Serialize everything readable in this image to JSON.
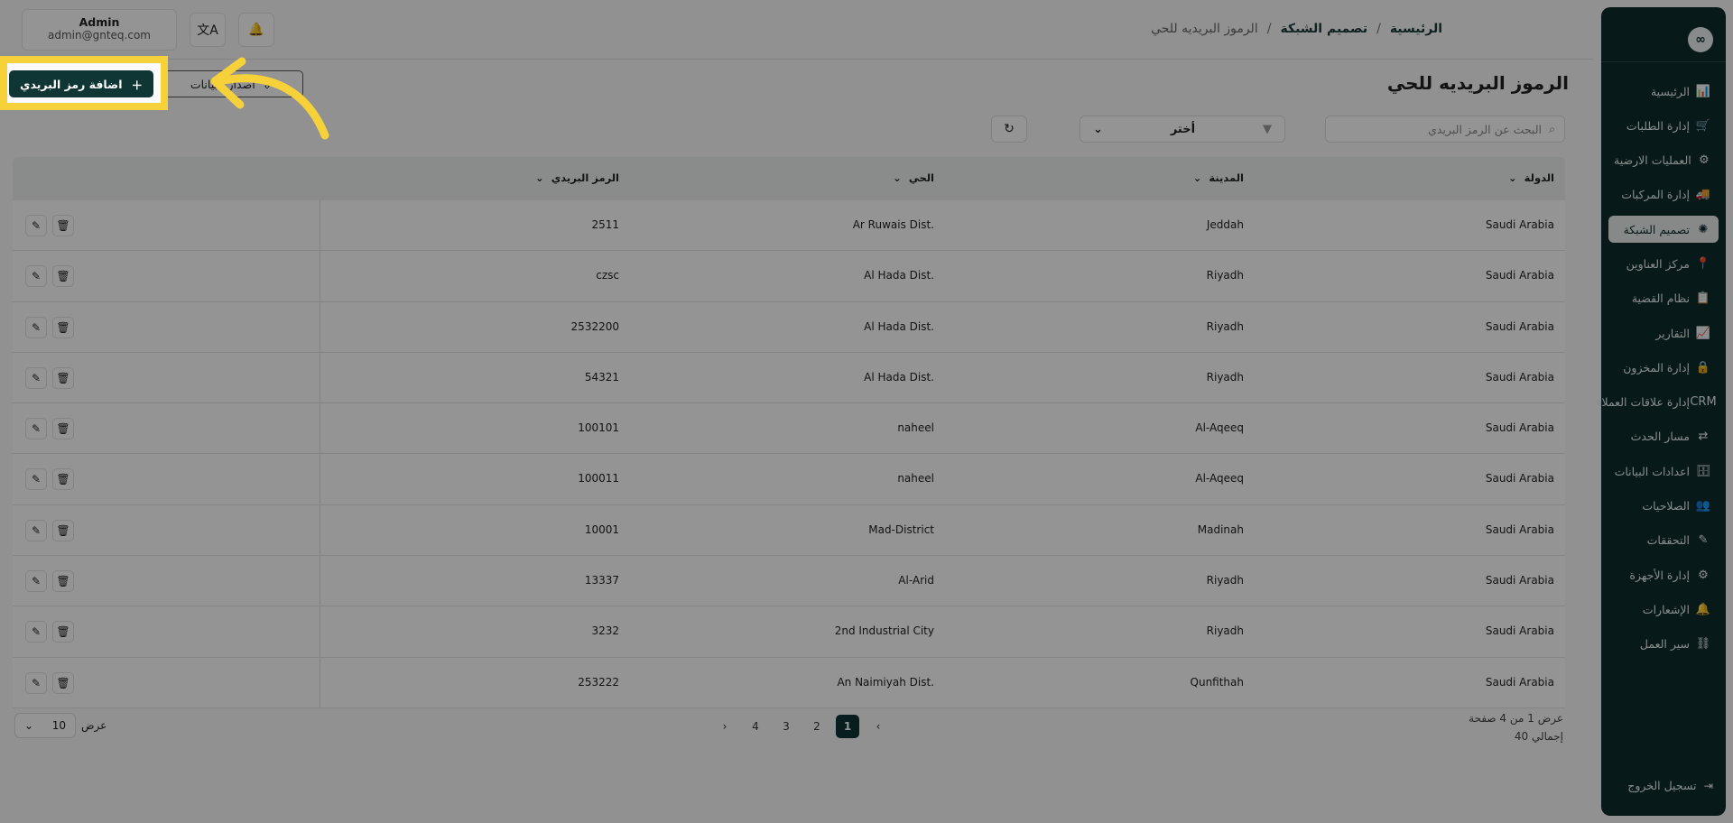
{
  "app": {
    "logo_glyph": "∞"
  },
  "sidebar": {
    "items": [
      {
        "label": "الرئيسية",
        "icon": "📊"
      },
      {
        "label": "إدارة الطلبات",
        "icon": "🛒"
      },
      {
        "label": "العمليات الارضية",
        "icon": "⚙"
      },
      {
        "label": "إدارة المركبات",
        "icon": "🚚"
      },
      {
        "label": "تصميم الشبكة",
        "icon": "✺"
      },
      {
        "label": "مركز العناوين",
        "icon": "📍"
      },
      {
        "label": "نظام القضية",
        "icon": "📋"
      },
      {
        "label": "التقارير",
        "icon": "📈"
      },
      {
        "label": "إدارة المخزون",
        "icon": "🔒"
      },
      {
        "label": "إدارة علاقات العملاء",
        "icon": "CRM"
      },
      {
        "label": "مسار الحدث",
        "icon": "⇄"
      },
      {
        "label": "اعدادات البيانات",
        "icon": "🗄"
      },
      {
        "label": "الصلاحيات",
        "icon": "👥"
      },
      {
        "label": "التحققات",
        "icon": "✎"
      },
      {
        "label": "إدارة الأجهزة",
        "icon": "⚙"
      },
      {
        "label": "الإشعارات",
        "icon": "🔔"
      },
      {
        "label": "سير العمل",
        "icon": "⛓"
      }
    ],
    "active_index": 4,
    "logout_label": "تسجيل الخروج"
  },
  "topbar": {
    "admin_name": "Admin",
    "admin_email": "admin@gnteq.com",
    "breadcrumb": [
      "الرئيسية",
      "تصميم الشبكة",
      "الرموز البريديه للحي"
    ]
  },
  "page": {
    "title": "الرموز البريديه للحي",
    "add_button": "اضافة رمز البريدي",
    "export_button": "اصدار البيانات",
    "search_placeholder": "البحث عن الرمز البريدي",
    "select_value": "أختر"
  },
  "table": {
    "headers": {
      "country": "الدولة",
      "city": "المدينة",
      "district": "الحي",
      "postal": "الرمز البريدي"
    },
    "rows": [
      {
        "country": "Saudi Arabia",
        "city": "Jeddah",
        "district": "Ar Ruwais Dist.",
        "postal": "2511"
      },
      {
        "country": "Saudi Arabia",
        "city": "Riyadh",
        "district": "Al Hada Dist.",
        "postal": "czsc"
      },
      {
        "country": "Saudi Arabia",
        "city": "Riyadh",
        "district": "Al Hada Dist.",
        "postal": "2532200"
      },
      {
        "country": "Saudi Arabia",
        "city": "Riyadh",
        "district": "Al Hada Dist.",
        "postal": "54321"
      },
      {
        "country": "Saudi Arabia",
        "city": "Al-Aqeeq",
        "district": "naheel",
        "postal": "100101"
      },
      {
        "country": "Saudi Arabia",
        "city": "Al-Aqeeq",
        "district": "naheel",
        "postal": "100011"
      },
      {
        "country": "Saudi Arabia",
        "city": "Madinah",
        "district": "Mad-District",
        "postal": "10001"
      },
      {
        "country": "Saudi Arabia",
        "city": "Riyadh",
        "district": "Al-Arid",
        "postal": "13337"
      },
      {
        "country": "Saudi Arabia",
        "city": "Riyadh",
        "district": "2nd Industrial City",
        "postal": "3232"
      },
      {
        "country": "Saudi Arabia",
        "city": "Qunfithah",
        "district": "An Naimiyah Dist.",
        "postal": "253222"
      }
    ]
  },
  "pagination": {
    "info_line1": "عرض 1 من 4 صفحة",
    "info_line2": "إجمالي 40",
    "pages": [
      "1",
      "2",
      "3",
      "4"
    ],
    "current": "1",
    "show_label": "عرض",
    "page_size": "10"
  },
  "colors": {
    "accent": "#0f3535",
    "highlight": "#f7d13a"
  }
}
